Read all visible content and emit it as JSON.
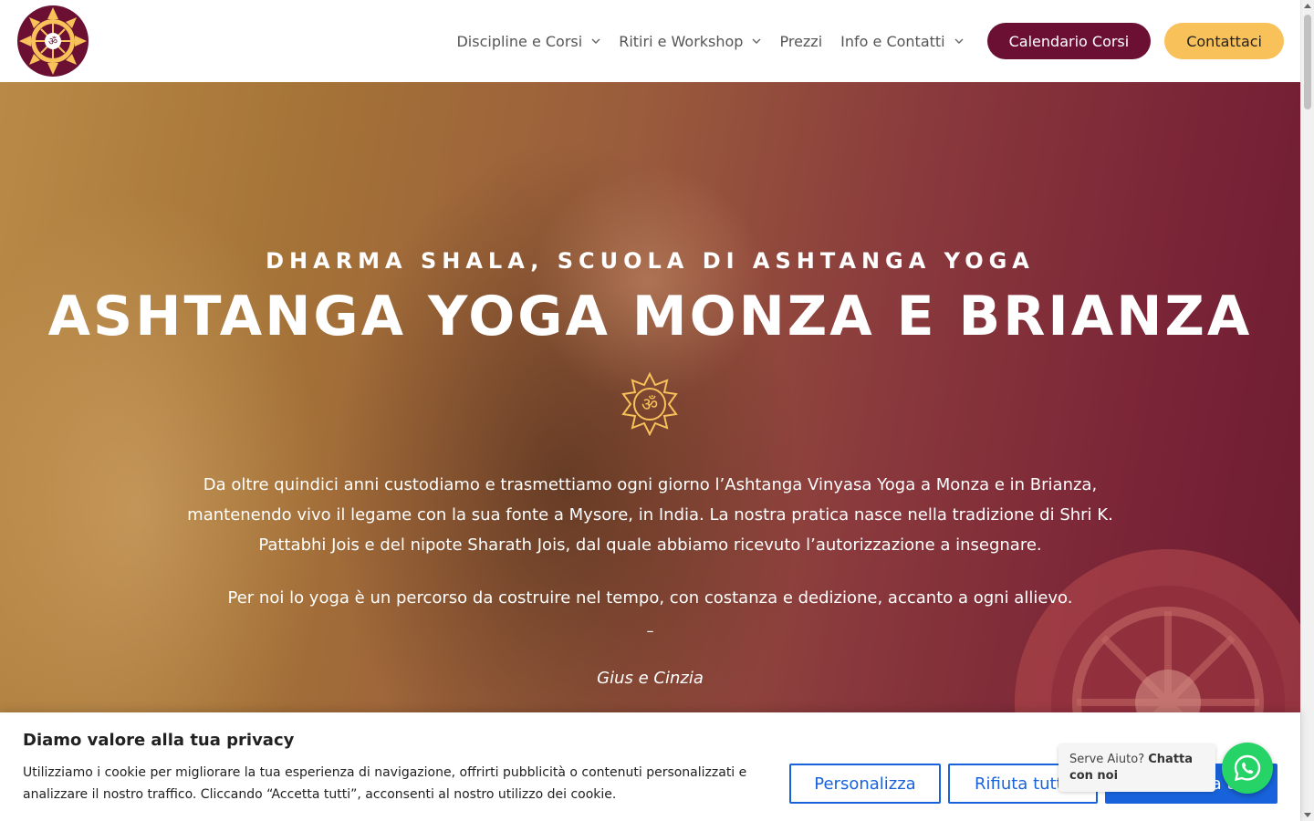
{
  "header": {
    "logo_name": "dharma-shala-logo",
    "nav": [
      {
        "label": "Discipline e Corsi",
        "has_dropdown": true
      },
      {
        "label": "Ritiri e Workshop",
        "has_dropdown": true
      },
      {
        "label": "Prezzi",
        "has_dropdown": false
      },
      {
        "label": "Info e Contatti",
        "has_dropdown": true
      }
    ],
    "calendar_button": "Calendario Corsi",
    "contact_button": "Contattaci"
  },
  "hero": {
    "subtitle": "DHARMA SHALA, SCUOLA DI ASHTANGA YOGA",
    "title": "ASHTANGA YOGA MONZA E BRIANZA",
    "paragraph1": "Da oltre quindici anni custodiamo e trasmettiamo ogni giorno l’Ashtanga Vinyasa Yoga a Monza e in Brianza, mantenendo vivo il legame con la sua fonte a Mysore, in India. La nostra pratica nasce nella tradizione di Shri K. Pattabhi Jois e del nipote Sharath Jois, dal quale abbiamo ricevuto l’autorizzazione a insegnare.",
    "paragraph2": "Per noi lo yoga è un percorso da costruire nel tempo, con costanza e dedizione, accanto a ogni allievo.",
    "dash": "–",
    "signature": "Gius e Cinzia"
  },
  "cookie": {
    "title": "Diamo valore alla tua privacy",
    "text": "Utilizziamo i cookie per migliorare la tua esperienza di navigazione, offrirti pubblicità o contenuti personalizzati e analizzare il nostro traffico. Cliccando “Accetta tutti”, acconsenti al nostro utilizzo dei cookie.",
    "customize": "Personalizza",
    "reject": "Rifiuta tutti",
    "accept": "Accetta tutti"
  },
  "whatsapp": {
    "prefix": "Serve Aiuto?",
    "cta": "Chatta con noi"
  },
  "colors": {
    "brand_burgundy": "#6b0f33",
    "brand_gold": "#f8c15a",
    "cookie_blue": "#1863dc",
    "whatsapp_green": "#25d366"
  }
}
